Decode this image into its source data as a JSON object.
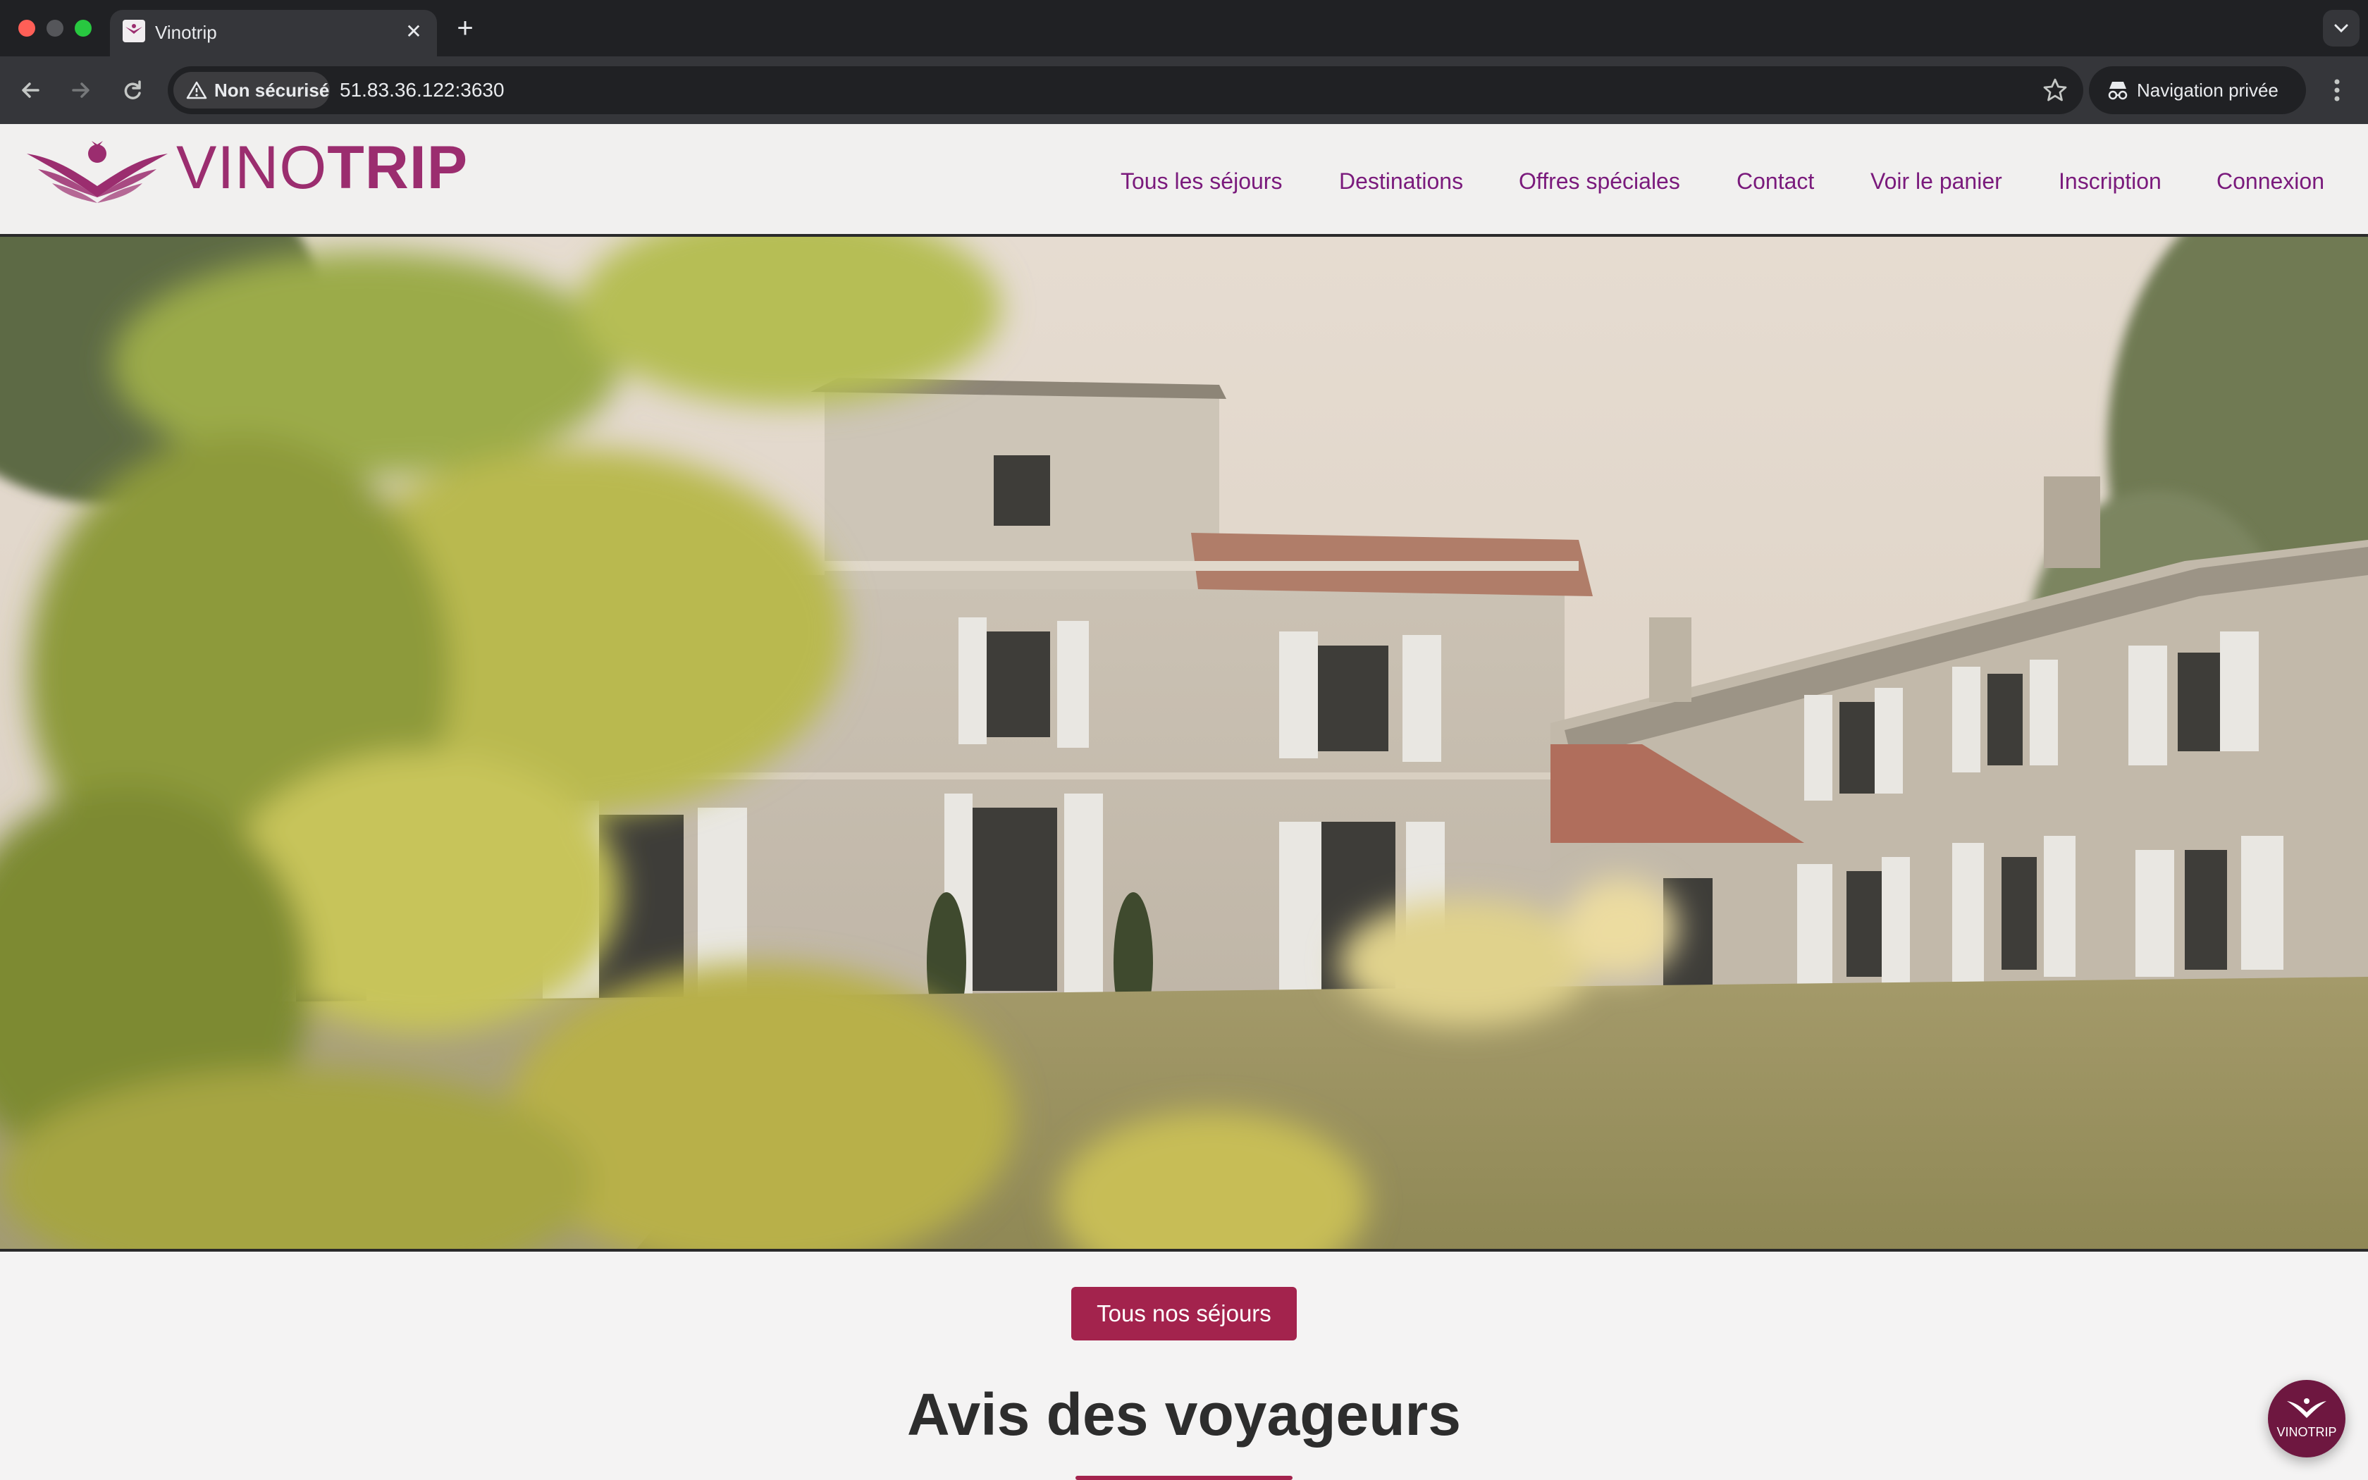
{
  "browser": {
    "tab_title": "Vinotrip",
    "security_label": "Non sécurisé",
    "url": "51.83.36.122:3630",
    "private_label": "Navigation privée"
  },
  "site": {
    "logo_thin": "VINO",
    "logo_bold": "TRIP",
    "nav": [
      "Tous les séjours",
      "Destinations",
      "Offres spéciales",
      "Contact",
      "Voir le panier",
      "Inscription",
      "Connexion"
    ],
    "cta_label": "Tous nos séjours",
    "section_title": "Avis des voyageurs",
    "fab_label": "VINOTRIP"
  },
  "colors": {
    "brand": "#9b2d6f",
    "nav_link": "#7a1a7c",
    "cta": "#a3234d"
  }
}
